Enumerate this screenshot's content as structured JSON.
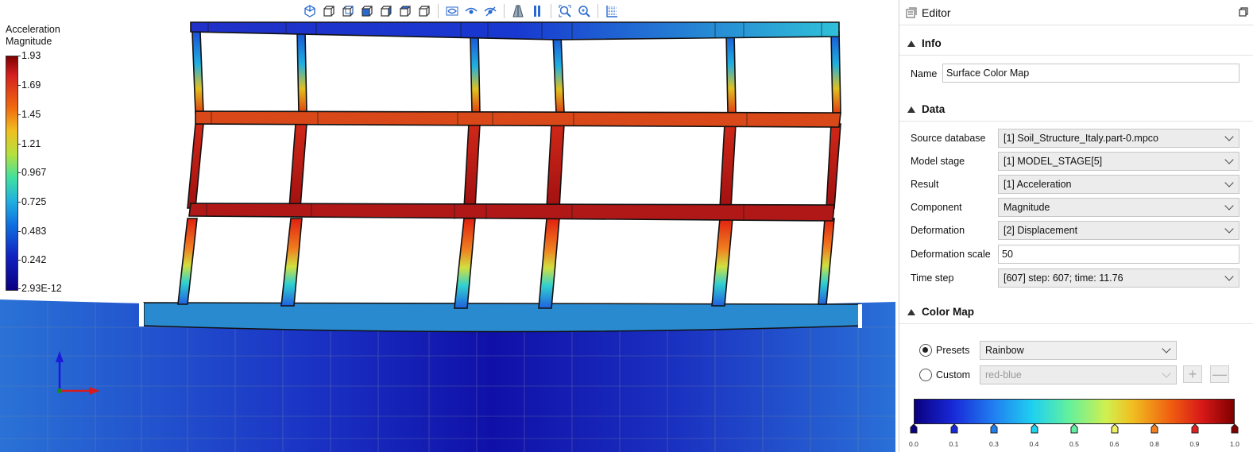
{
  "toolbar": {
    "icons": [
      "iso-view-icon",
      "front-view-icon",
      "back-view-icon",
      "left-view-icon",
      "right-view-icon",
      "top-view-icon",
      "bottom-view-icon",
      "hide-icon",
      "show-icon",
      "show-only-icon",
      "perspective-icon",
      "parallel-icon",
      "zoom-fit-icon",
      "zoom-icon",
      "grid-icon"
    ]
  },
  "legend": {
    "title": "Acceleration Magnitude",
    "ticks": [
      "1.93",
      "1.69",
      "1.45",
      "1.21",
      "0.967",
      "0.725",
      "0.483",
      "0.242",
      "2.93E-12"
    ]
  },
  "editor": {
    "title": "Editor",
    "info": {
      "header": "Info",
      "name_label": "Name",
      "name_value": "Surface Color Map"
    },
    "data": {
      "header": "Data",
      "source_label": "Source database",
      "source_value": "[1] Soil_Structure_Italy.part-0.mpco",
      "stage_label": "Model stage",
      "stage_value": "[1] MODEL_STAGE[5]",
      "result_label": "Result",
      "result_value": "[1] Acceleration",
      "component_label": "Component",
      "component_value": "Magnitude",
      "deformation_label": "Deformation",
      "deformation_value": "[2] Displacement",
      "scale_label": "Deformation scale",
      "scale_value": "50",
      "time_label": "Time step",
      "time_value": "[607] step: 607; time: 11.76"
    },
    "colormap": {
      "header": "Color Map",
      "presets_label": "Presets",
      "presets_value": "Rainbow",
      "custom_label": "Custom",
      "custom_value": "red-blue",
      "add_symbol": "+",
      "remove_symbol": "—",
      "stops": [
        "0.0",
        "0.1",
        "0.3",
        "0.4",
        "0.5",
        "0.6",
        "0.8",
        "0.9",
        "1.0"
      ],
      "stop_positions": [
        0.0,
        0.125,
        0.25,
        0.375,
        0.5,
        0.625,
        0.75,
        0.875,
        1.0
      ],
      "stop_colors": [
        "#0a0080",
        "#1828d8",
        "#2080f0",
        "#20d0f0",
        "#60f0a0",
        "#f0f060",
        "#f08020",
        "#e02020",
        "#7f0000"
      ]
    }
  }
}
